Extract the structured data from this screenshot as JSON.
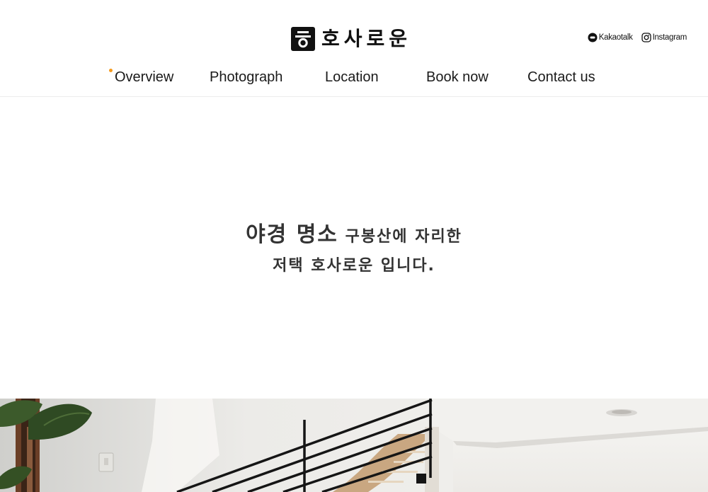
{
  "brand": {
    "logo_text": "호사로운"
  },
  "social": [
    {
      "label": "Kakaotalk",
      "icon": "kakao-chat-icon"
    },
    {
      "label": "Instagram",
      "icon": "instagram-icon"
    }
  ],
  "nav": {
    "items": [
      {
        "label": "Overview",
        "active": true
      },
      {
        "label": "Photograph",
        "active": false
      },
      {
        "label": "Location",
        "active": false
      },
      {
        "label": "Book now",
        "active": false
      },
      {
        "label": "Contact us",
        "active": false
      }
    ]
  },
  "hero": {
    "line1_emphasis": "야경 명소",
    "line1_rest": " 구봉산에 자리한",
    "line2": "저택 호사로운 입니다."
  },
  "colors": {
    "accent": "#f59a1e",
    "text": "#333333",
    "brand_dark": "#111111"
  }
}
